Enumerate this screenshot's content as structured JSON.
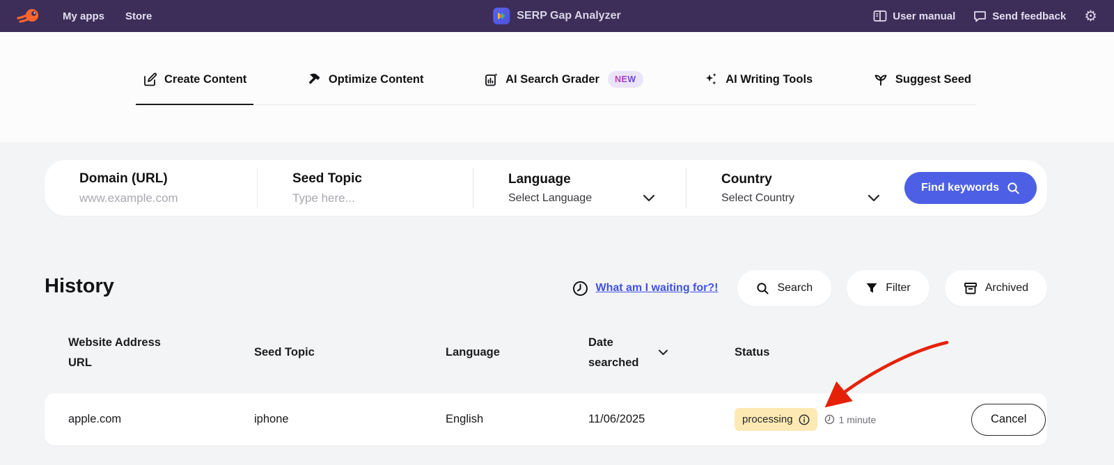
{
  "header": {
    "nav": [
      {
        "label": "My apps"
      },
      {
        "label": "Store"
      }
    ],
    "app_title": "SERP Gap Analyzer",
    "actions": [
      {
        "label": "User manual"
      },
      {
        "label": "Send feedback"
      }
    ]
  },
  "tabs": [
    {
      "label": "Create Content",
      "active": true
    },
    {
      "label": "Optimize Content",
      "active": false
    },
    {
      "label": "AI Search Grader",
      "active": false,
      "badge": "NEW"
    },
    {
      "label": "AI Writing Tools",
      "active": false
    },
    {
      "label": "Suggest Seed",
      "active": false
    }
  ],
  "form": {
    "fields": [
      {
        "label": "Domain (URL)",
        "placeholder": "www.example.com",
        "type": "input"
      },
      {
        "label": "Seed Topic",
        "placeholder": "Type here...",
        "type": "input"
      },
      {
        "label": "Language",
        "value": "Select Language",
        "type": "select"
      },
      {
        "label": "Country",
        "value": "Select Country",
        "type": "select"
      }
    ],
    "submit_label": "Find keywords"
  },
  "history": {
    "title": "History",
    "waiting_link": "What am I waiting for?!",
    "buttons": [
      {
        "label": "Search"
      },
      {
        "label": "Filter"
      },
      {
        "label": "Archived"
      }
    ],
    "table": {
      "columns": [
        "Website Address URL",
        "Seed Topic",
        "Language",
        "Date searched",
        "Status"
      ],
      "rows": [
        {
          "website": "apple.com",
          "seed_topic": "iphone",
          "language": "English",
          "date": "11/06/2025",
          "status": "processing",
          "elapsed": "1 minute",
          "action": "Cancel"
        }
      ]
    }
  },
  "colors": {
    "header_bg": "#3d2e59",
    "accent_blue": "#4d60e5",
    "link_blue": "#4053e3",
    "processing_badge_bg": "#fce9b4",
    "new_badge_bg": "#eae4fb",
    "arrow_red": "#e52207",
    "logo_orange": "#ff642d",
    "page_bg": "#f3f4f6"
  }
}
